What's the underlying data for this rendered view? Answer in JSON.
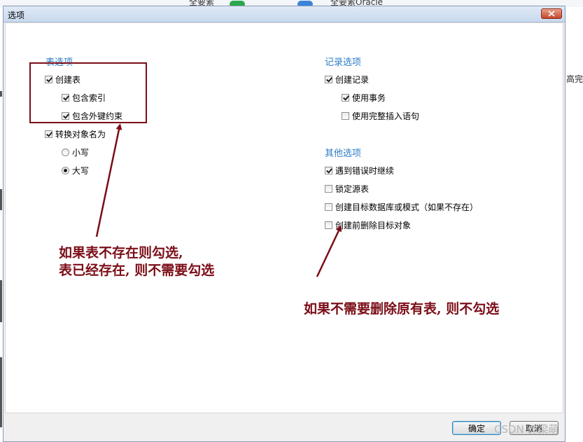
{
  "background": {
    "top_left_text": "全要素",
    "top_right_text": "全要素Oracle",
    "right_edge_text": "高完!"
  },
  "dialog": {
    "title": "选项",
    "close_label": "×",
    "ok_label": "确定",
    "cancel_label": "取消"
  },
  "table_options": {
    "title": "表选项",
    "create_table": {
      "label": "创建表",
      "checked": true
    },
    "include_indexes": {
      "label": "包含索引",
      "checked": true
    },
    "include_foreign_keys": {
      "label": "包含外键约束",
      "checked": true
    },
    "convert_object_names": {
      "label": "转换对象名为",
      "checked": true
    },
    "lowercase": {
      "label": "小写",
      "selected": false
    },
    "uppercase": {
      "label": "大写",
      "selected": true
    }
  },
  "record_options": {
    "title": "记录选项",
    "create_records": {
      "label": "创建记录",
      "checked": true
    },
    "use_transaction": {
      "label": "使用事务",
      "checked": true
    },
    "use_complete_insert": {
      "label": "使用完整插入语句",
      "checked": false
    }
  },
  "other_options": {
    "title": "其他选项",
    "continue_on_error": {
      "label": "遇到错误时继续",
      "checked": true
    },
    "lock_source_table": {
      "label": "锁定源表",
      "checked": false
    },
    "create_target_db": {
      "label": "创建目标数据库或模式（如果不存在）",
      "checked": false
    },
    "drop_target_objects": {
      "label": "创建前删除目标对象",
      "checked": false
    }
  },
  "annotations": {
    "left_line1": "如果表不存在则勾选,",
    "left_line2": "表已经存在, 则不需要勾选",
    "right_line": "如果不需要删除原有表, 则不勾选"
  },
  "watermark": "CSDN @梁萌",
  "colors": {
    "annotation": "#7b0d17",
    "group_title": "#2e7cc6",
    "close_button": "#c4452a"
  }
}
